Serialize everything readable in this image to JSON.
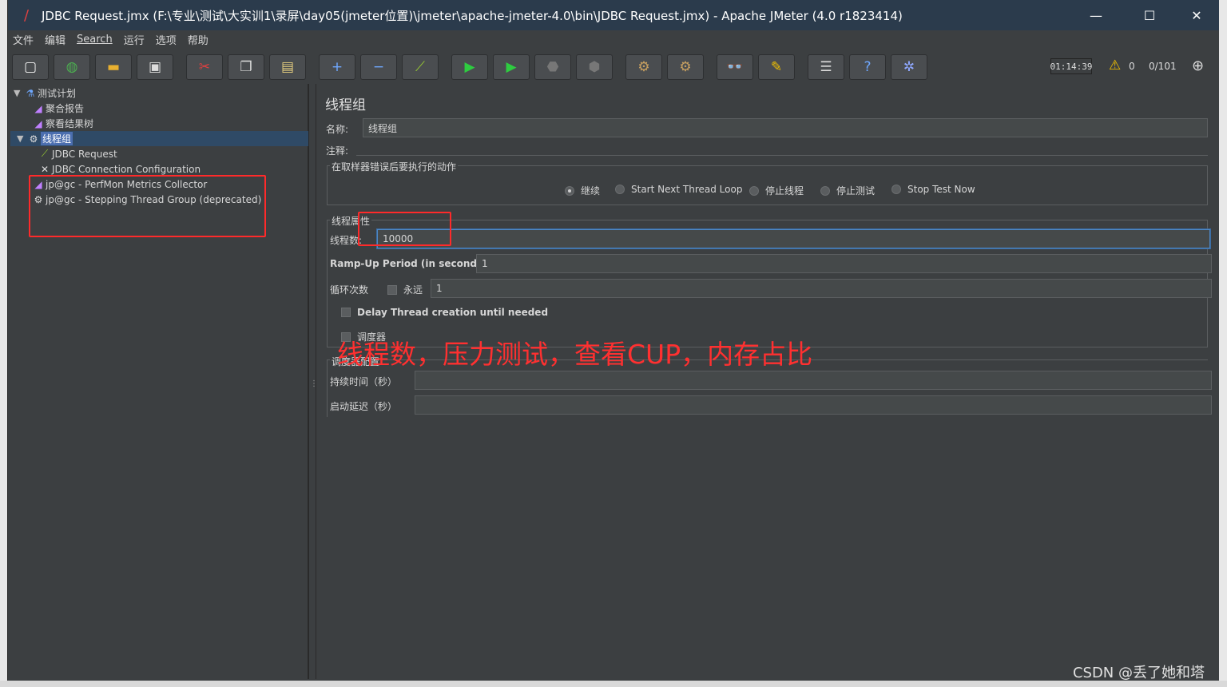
{
  "window": {
    "title": "JDBC Request.jmx (F:\\专业\\测试\\大实训1\\录屏\\day05(jmeter位置)\\jmeter\\apache-jmeter-4.0\\bin\\JDBC Request.jmx) - Apache JMeter (4.0 r1823414)",
    "minimize": "—",
    "maximize": "☐",
    "close": "✕"
  },
  "menu": [
    "文件",
    "编辑",
    "Search",
    "运行",
    "选项",
    "帮助"
  ],
  "toolbar_icons": [
    "new-icon",
    "templates-icon",
    "open-icon",
    "save-icon",
    "cut-icon",
    "copy-icon",
    "paste-icon",
    "expand-icon",
    "collapse-icon",
    "toggle-icon",
    "start-icon",
    "start-no-pause-icon",
    "stop-icon",
    "shutdown-icon",
    "clear-icon",
    "clear-all-icon",
    "search-icon",
    "reset-search-icon",
    "function-helper-icon",
    "help-icon",
    "remote-icon"
  ],
  "status": {
    "timer": "01:14:39",
    "warnings": "0",
    "threads": "0/101"
  },
  "tree": {
    "items": [
      {
        "label": "测试计划",
        "icon": "test-plan-icon"
      },
      {
        "label": "聚合报告",
        "icon": "listener-icon"
      },
      {
        "label": "察看结果树",
        "icon": "listener-icon"
      },
      {
        "label": "线程组",
        "icon": "thread-group-icon"
      },
      {
        "label": "JDBC Request",
        "icon": "sampler-icon"
      },
      {
        "label": "JDBC Connection Configuration",
        "icon": "config-icon"
      },
      {
        "label": "jp@gc - PerfMon Metrics Collector",
        "icon": "listener-icon"
      },
      {
        "label": "jp@gc - Stepping Thread Group (deprecated)",
        "icon": "thread-group-icon"
      }
    ]
  },
  "panel": {
    "title": "线程组",
    "name_label": "名称:",
    "name_value": "线程组",
    "comment_label": "注释:",
    "comment_value": "",
    "on_error_title": "在取样器错误后要执行的动作",
    "on_error_options": [
      "继续",
      "Start Next Thread Loop",
      "停止线程",
      "停止测试",
      "Stop Test Now"
    ],
    "on_error_selected": 0,
    "thread_props_title": "线程属性",
    "threads_label": "线程数:",
    "threads_value": "10000",
    "rampup_label": "Ramp-Up Period (in seconds):",
    "rampup_value": "1",
    "loop_label": "循环次数",
    "forever_label": "永远",
    "loop_value": "1",
    "delay_label": "Delay Thread creation until needed",
    "scheduler_label": "调度器",
    "scheduler_config_title": "调度器配置",
    "duration_label": "持续时间（秒）",
    "duration_value": "",
    "startup_delay_label": "启动延迟（秒）",
    "startup_delay_value": ""
  },
  "annotation": "线程数，压力测试，查看CUP，内存占比",
  "watermark": "CSDN @丢了她和塔"
}
